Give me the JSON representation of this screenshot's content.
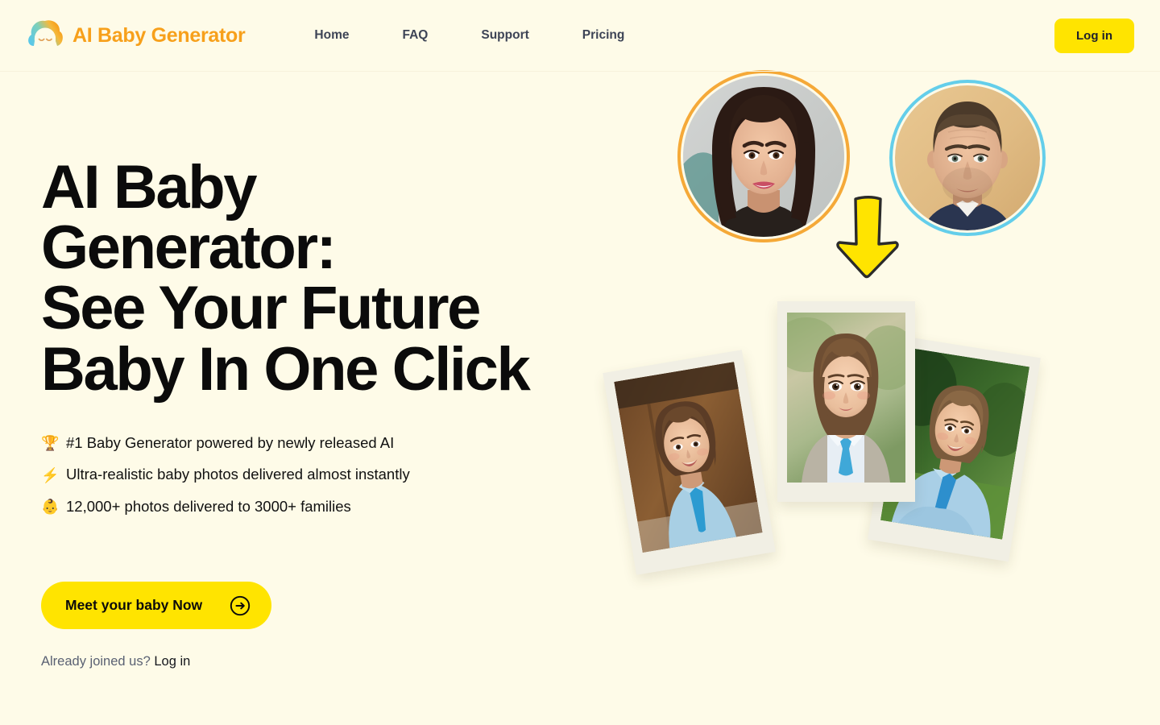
{
  "theme": {
    "page_bg": "#FEFBE8",
    "accent_yellow": "#FFE400",
    "brand_orange": "#F7A01B",
    "nav_text": "#3D4456",
    "mom_ring": "#F5A938",
    "dad_ring": "#64CEEA",
    "polaroid_frame": "#F1EFE4"
  },
  "header": {
    "logo_icon": "baby-face-logo-icon",
    "brand_name": "AI Baby Generator",
    "nav": [
      {
        "label": "Home"
      },
      {
        "label": "FAQ"
      },
      {
        "label": "Support"
      },
      {
        "label": "Pricing"
      }
    ],
    "login_label": "Log in"
  },
  "hero": {
    "headline_lines": [
      "AI Baby",
      "Generator:",
      "See Your Future",
      "Baby In One Click"
    ],
    "headline_full": "AI Baby Generator: See Your Future Baby In One Click",
    "bullets": [
      {
        "emoji": "🏆",
        "icon_name": "trophy-emoji",
        "text": "#1 Baby Generator powered by newly released AI"
      },
      {
        "emoji": "⚡",
        "icon_name": "lightning-emoji",
        "text": "Ultra-realistic baby photos delivered almost instantly"
      },
      {
        "emoji": "👶",
        "icon_name": "baby-emoji",
        "text": "12,000+ photos delivered to 3000+ families"
      }
    ],
    "cta_label": "Meet your baby Now",
    "cta_icon": "circle-arrow-right-icon",
    "already_prefix": "Already joined us? ",
    "already_link": "Log in"
  },
  "visual": {
    "parent_photos": [
      {
        "name": "mother-avatar",
        "ring_color": "#F5A938"
      },
      {
        "name": "father-avatar",
        "ring_color": "#64CEEA"
      }
    ],
    "arrow_icon": "down-arrow-icon",
    "baby_photos": [
      {
        "name": "baby-photo-left"
      },
      {
        "name": "baby-photo-center"
      },
      {
        "name": "baby-photo-right"
      }
    ]
  }
}
